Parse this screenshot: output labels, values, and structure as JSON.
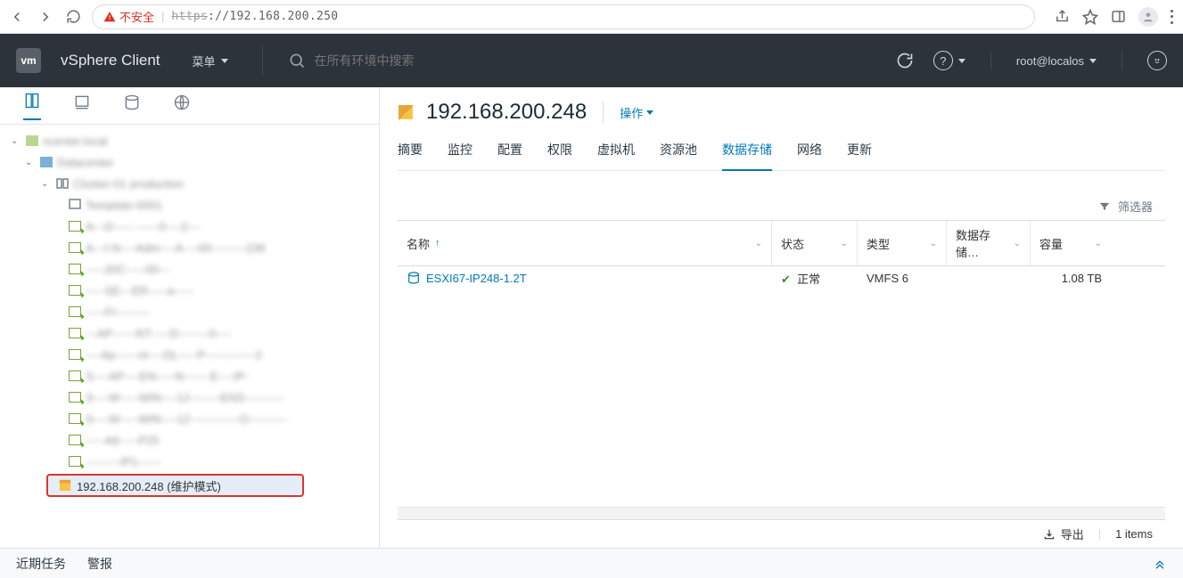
{
  "chrome": {
    "security_label": "不安全",
    "url_strike": "https",
    "url_rest": "://192.168.200.250"
  },
  "header": {
    "logo_text": "vm",
    "brand": "vSphere Client",
    "menu_label": "菜单",
    "search_placeholder": "在所有环境中搜索",
    "user": "root@localos"
  },
  "tree": {
    "selected_host_label": "192.168.200.248 (维护模式)"
  },
  "page": {
    "title": "192.168.200.248",
    "actions_label": "操作"
  },
  "tabs": [
    "摘要",
    "监控",
    "配置",
    "权限",
    "虚拟机",
    "资源池",
    "数据存储",
    "网络",
    "更新"
  ],
  "active_tab_index": 6,
  "table": {
    "filter_label": "筛选器",
    "columns": {
      "name": "名称",
      "status": "状态",
      "type": "类型",
      "dscluster": "数据存储…",
      "capacity": "容量"
    },
    "rows": [
      {
        "name": "ESXI67-IP248-1.2T",
        "status": "正常",
        "type": "VMFS 6",
        "capacity": "1.08 TB"
      }
    ],
    "export_label": "导出",
    "count_label": "1 items"
  },
  "bottom": {
    "recent_tasks": "近期任务",
    "alarms": "警报"
  }
}
